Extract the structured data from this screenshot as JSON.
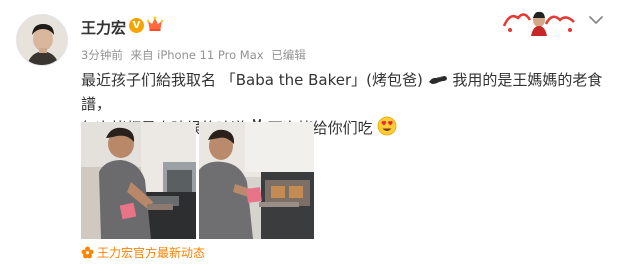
{
  "author": {
    "name": "王力宏",
    "verified_badge": "V",
    "avatar_icon": "avatar-portrait",
    "crown_icon": "crown-icon"
  },
  "meta": {
    "time": "3分钟前",
    "device": "来自 iPhone 11 Pro Max",
    "edited": "已编辑"
  },
  "post": {
    "line1_before": "最近孩子们給我取名 「Baba the Baker」(烤包爸)",
    "line1_after": "我用的是王媽媽的老食譜，",
    "line2_before": "每次烤都是小時候的味道",
    "line2_after": "下次烤给你们吃",
    "emojis": [
      "fist-bump-icon",
      "victory-hand-icon",
      "heart-eyes-icon"
    ]
  },
  "photos": [
    {
      "name": "photo-baking-1"
    },
    {
      "name": "photo-baking-2"
    }
  ],
  "source": {
    "label": "王力宏官方最新动态",
    "icon": "flower-icon"
  },
  "colors": {
    "accent": "#ff8200",
    "meta": "#939393",
    "text": "#333333",
    "verified": "#f7a400"
  }
}
